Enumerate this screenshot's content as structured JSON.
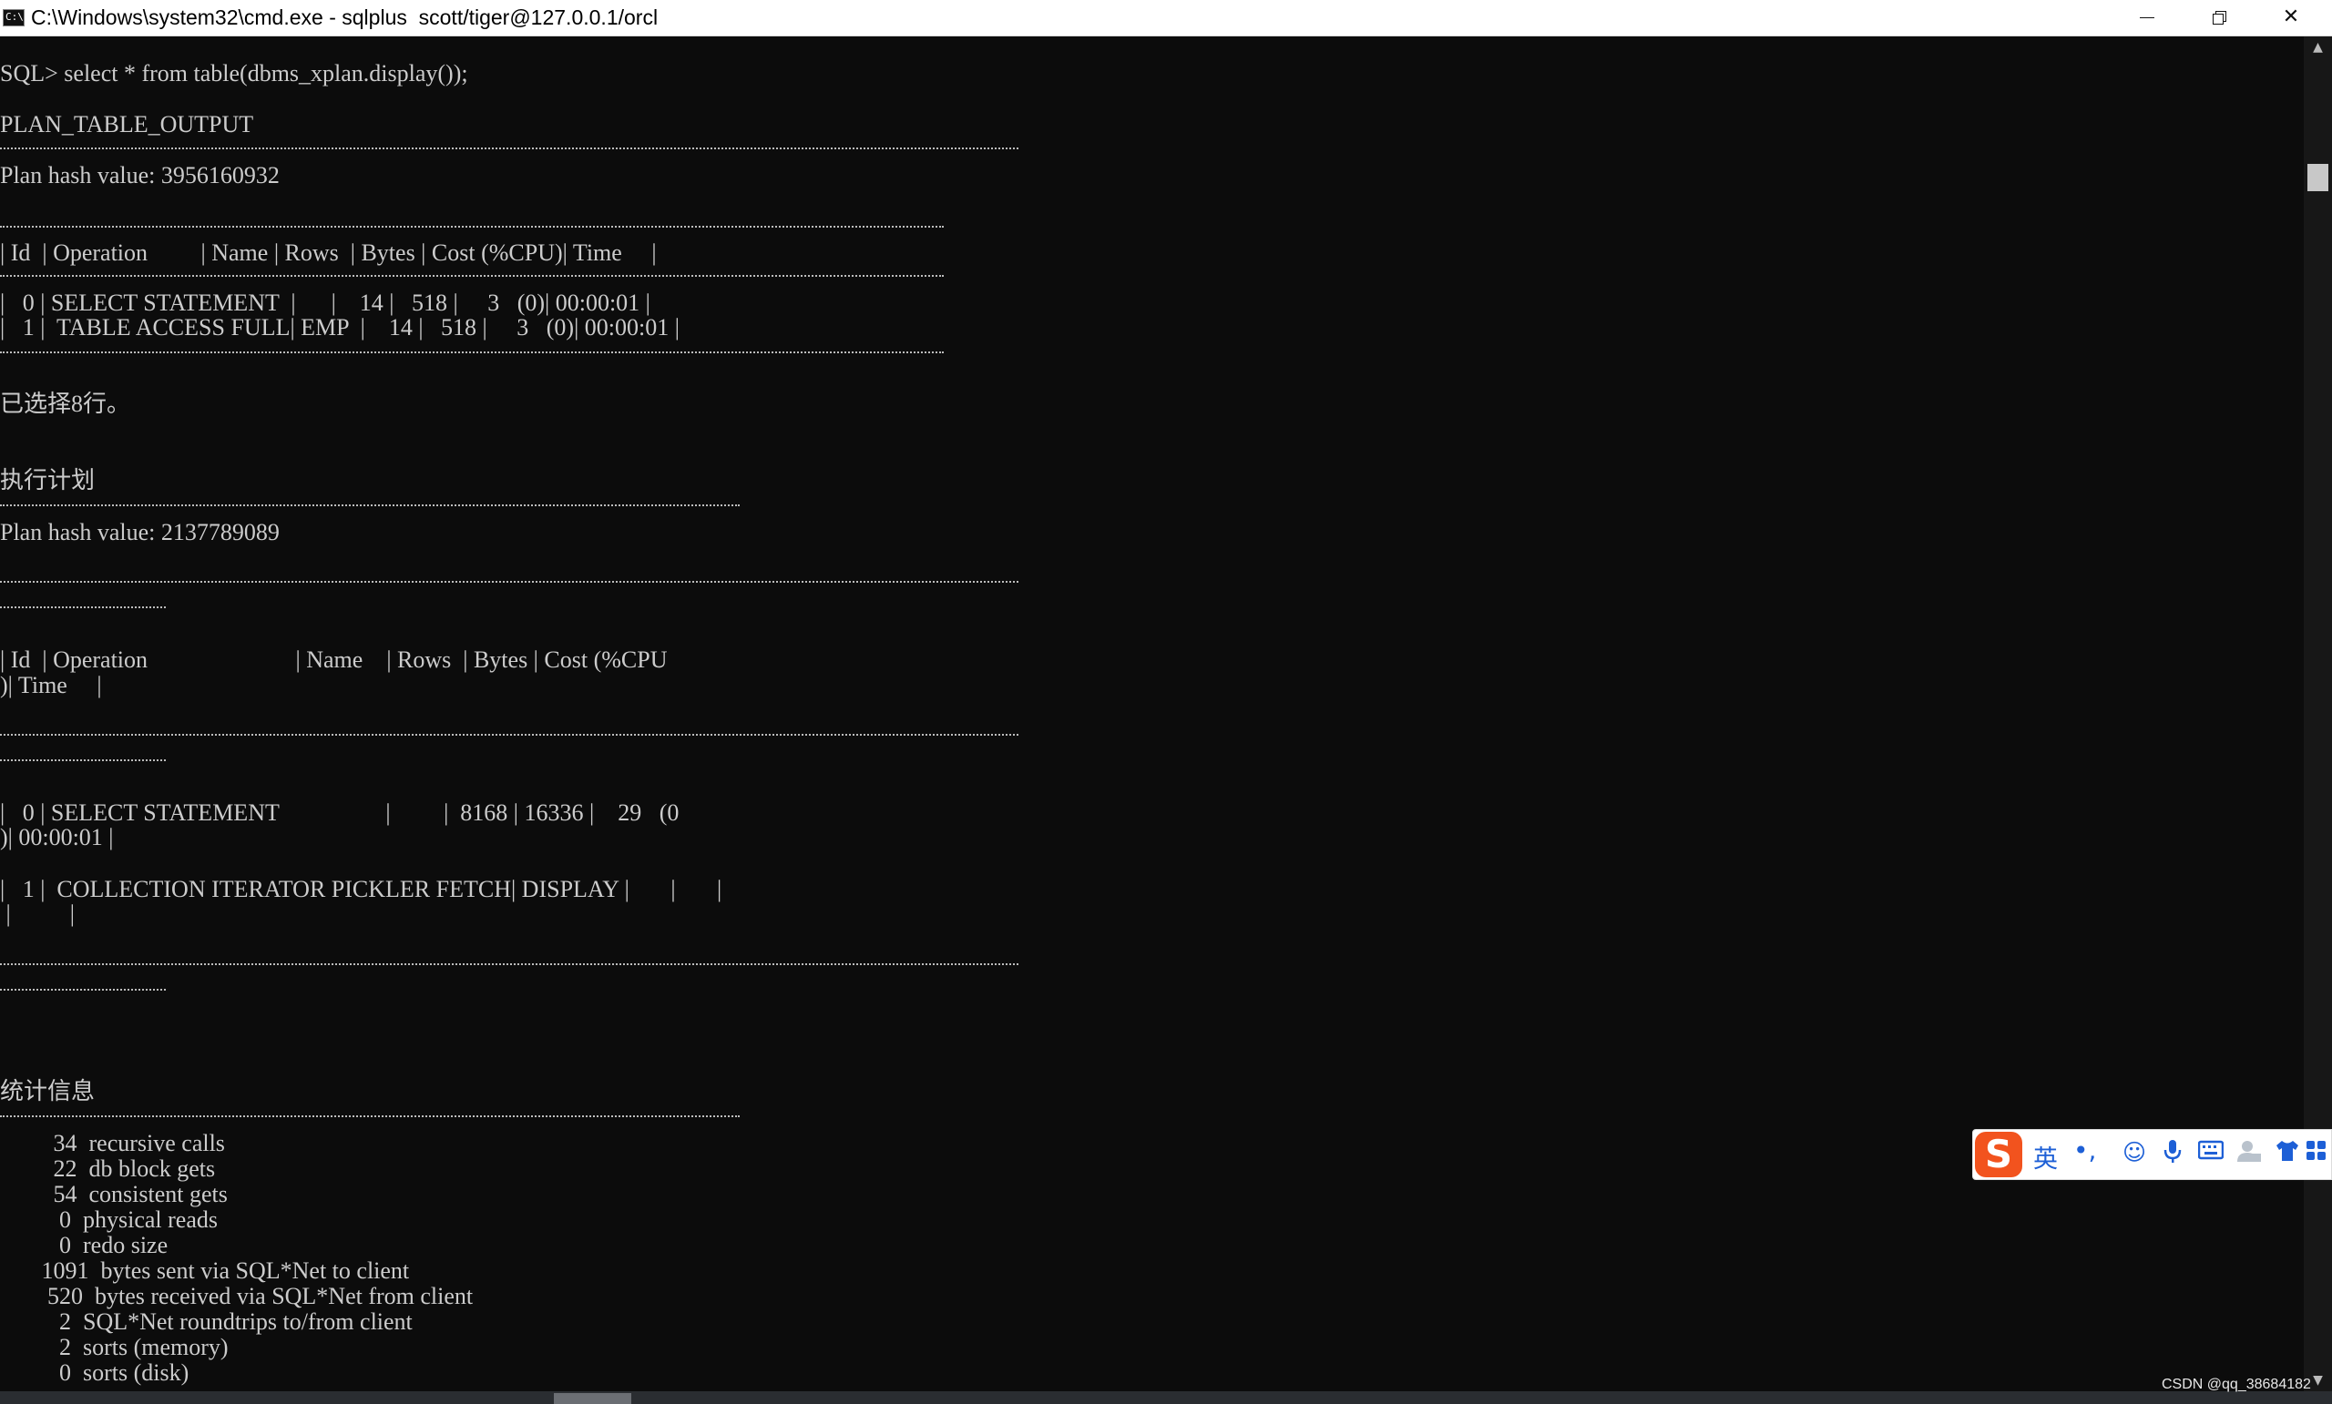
{
  "window": {
    "icon_text": "C:\\",
    "title": "C:\\Windows\\system32\\cmd.exe - sqlplus  scott/tiger@127.0.0.1/orcl",
    "close_glyph": "✕"
  },
  "console": {
    "lines": [
      "SQL> select * from table(dbms_xplan.display());",
      "PLAN_TABLE_OUTPUT",
      "Plan hash value: 3956160932",
      "| Id  | Operation         | Name | Rows  | Bytes | Cost (%CPU)| Time     |",
      "|   0 | SELECT STATEMENT  |      |    14 |   518 |     3   (0)| 00:00:01 |",
      "|   1 |  TABLE ACCESS FULL| EMP  |    14 |   518 |     3   (0)| 00:00:01 |",
      "已选择8行。",
      "执行计划",
      "Plan hash value: 2137789089",
      "| Id  | Operation                         | Name    | Rows  | Bytes | Cost (%CPU",
      ")| Time     |",
      "|   0 | SELECT STATEMENT                  |         |  8168 | 16336 |    29   (0",
      ")| 00:00:01 |",
      "|   1 |  COLLECTION ITERATOR PICKLER FETCH| DISPLAY |       |       |",
      " |          |",
      "统计信息",
      "         34  recursive calls",
      "         22  db block gets",
      "         54  consistent gets",
      "          0  physical reads",
      "          0  redo size",
      "       1091  bytes sent via SQL*Net to client",
      "        520  bytes received via SQL*Net from client",
      "          2  SQL*Net roundtrips to/from client",
      "          2  sorts (memory)",
      "          0  sorts (disk)"
    ]
  },
  "ime": {
    "logo": "S",
    "lang": "英",
    "punct": "•,",
    "icons": [
      "smiley-icon",
      "microphone-icon",
      "keyboard-icon",
      "user-icon",
      "shirt-icon",
      "apps-icon"
    ]
  },
  "scrollbar": {
    "up": "▲",
    "down": "▼"
  },
  "watermark": "CSDN @qq_38684182"
}
